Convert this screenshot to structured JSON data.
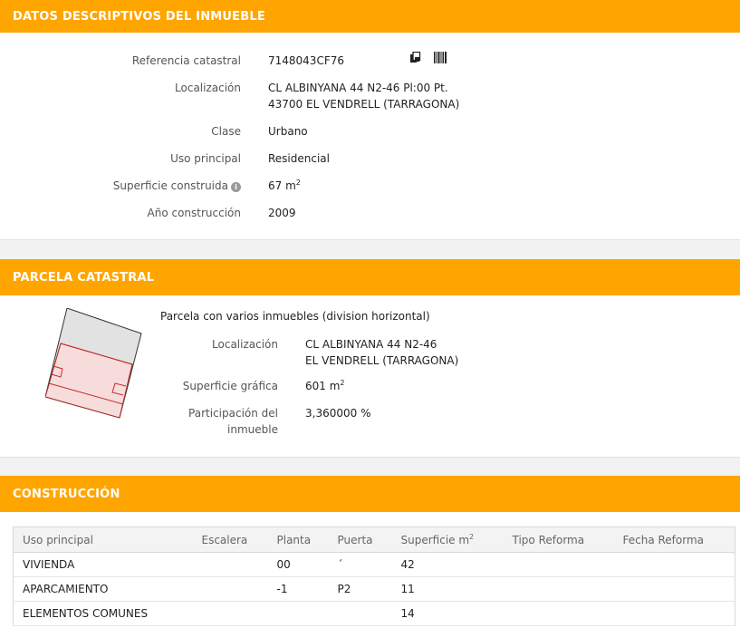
{
  "colors": {
    "accent": "#ffa500",
    "parcel_red": "#cc2a2a",
    "parcel_fill": "#f7dcdc",
    "parcel_gray": "#e2e2e2"
  },
  "section1": {
    "title": "DATOS DESCRIPTIVOS DEL INMUEBLE",
    "ref_label": "Referencia catastral",
    "ref_value": "7148043CF76",
    "ref_icons": [
      "copy-icon",
      "barcode-icon"
    ],
    "loc_label": "Localización",
    "loc_line1": "CL ALBINYANA 44 N2-46 Pl:00 Pt.",
    "loc_line2": "43700 EL VENDRELL (TARRAGONA)",
    "clase_label": "Clase",
    "clase_value": "Urbano",
    "uso_label": "Uso principal",
    "uso_value": "Residencial",
    "sup_label": "Superficie construida",
    "sup_value": "67 m",
    "sup_unit_exp": "2",
    "anio_label": "Año construcción",
    "anio_value": "2009"
  },
  "section2": {
    "title": "PARCELA CATASTRAL",
    "parcela_title": "Parcela con varios inmuebles (division horizontal)",
    "loc_label": "Localización",
    "loc_line1": "CL ALBINYANA 44 N2-46",
    "loc_line2": "EL VENDRELL (TARRAGONA)",
    "sup_label": "Superficie gráfica",
    "sup_value": "601 m",
    "sup_unit_exp": "2",
    "part_label_line1": "Participación del",
    "part_label_line2": "inmueble",
    "part_value": "3,360000 %"
  },
  "section3": {
    "title": "CONSTRUCCIÓN",
    "headers": [
      "Uso principal",
      "Escalera",
      "Planta",
      "Puerta",
      "Superficie m",
      "Tipo Reforma",
      "Fecha Reforma"
    ],
    "sup_header_exp": "2",
    "rows": [
      [
        "VIVIENDA",
        "",
        "00",
        "´",
        "42",
        "",
        ""
      ],
      [
        "APARCAMIENTO",
        "",
        "-1",
        "P2",
        "11",
        "",
        ""
      ],
      [
        "ELEMENTOS COMUNES",
        "",
        "",
        "",
        "14",
        "",
        ""
      ]
    ]
  }
}
